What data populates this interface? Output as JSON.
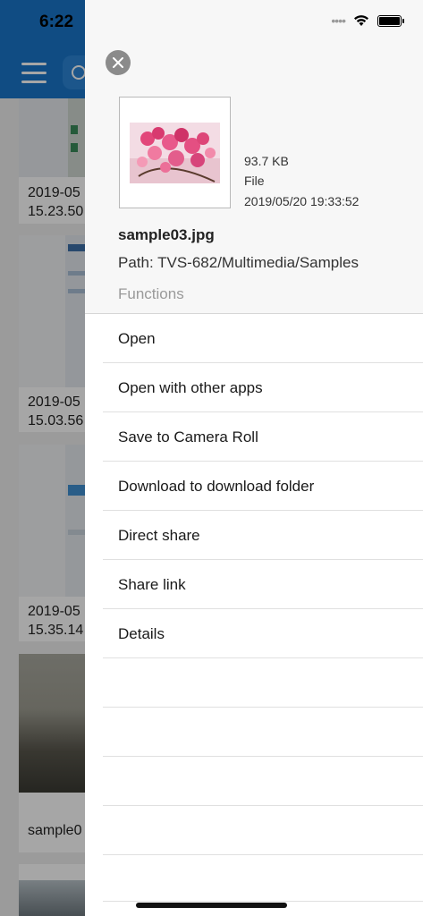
{
  "status_bar": {
    "time": "6:22"
  },
  "background": {
    "cards": [
      {
        "label_line1": "2019-05",
        "label_line2": "15.23.50"
      },
      {
        "label_line1": "2019-05",
        "label_line2": "15.03.56"
      },
      {
        "label_line1": "2019-05",
        "label_line2": "15.35.14"
      },
      {
        "label_line1": "sample0",
        "label_line2": ""
      }
    ]
  },
  "file": {
    "size": "93.7 KB",
    "kind": "File",
    "date": "2019/05/20 19:33:52",
    "name": "sample03.jpg",
    "path": "Path: TVS-682/Multimedia/Samples"
  },
  "section_label": "Functions",
  "menu": [
    {
      "label": "Open"
    },
    {
      "label": "Open with other apps"
    },
    {
      "label": "Save to Camera Roll"
    },
    {
      "label": "Download to download folder"
    },
    {
      "label": "Direct share"
    },
    {
      "label": "Share link"
    },
    {
      "label": "Details"
    },
    {
      "label": ""
    },
    {
      "label": ""
    },
    {
      "label": ""
    },
    {
      "label": ""
    },
    {
      "label": ""
    }
  ],
  "colors": {
    "nav": "#1976c9",
    "close": "#8b8b8b"
  }
}
